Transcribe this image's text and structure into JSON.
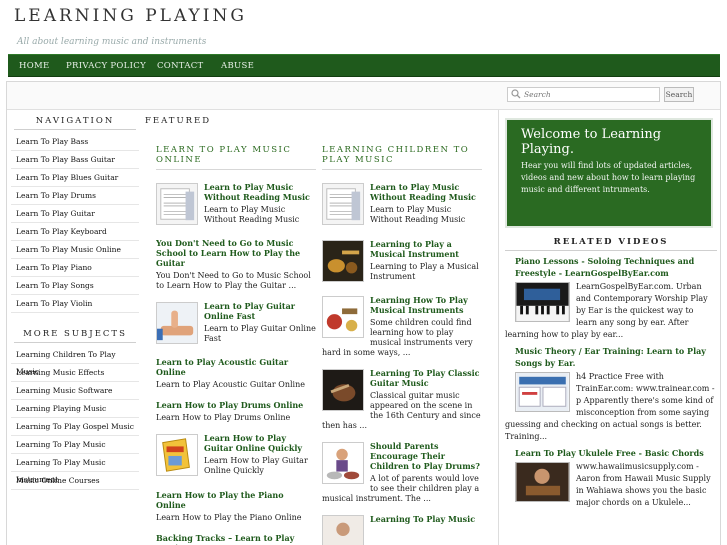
{
  "header": {
    "title": "LEARNING PLAYING",
    "tagline": "All about learning music and instruments"
  },
  "nav": {
    "items": [
      {
        "label": "HOME"
      },
      {
        "label": "PRIVACY POLICY"
      },
      {
        "label": "CONTACT"
      },
      {
        "label": "ABUSE"
      }
    ]
  },
  "search": {
    "placeholder": "Search",
    "button_label": "Search"
  },
  "sidebar": {
    "navigation_title": "NAVIGATION",
    "navigation_items": [
      "Learn To Play Bass",
      "Learn To Play Bass Guitar",
      "Learn To Play Blues Guitar",
      "Learn To Play Drums",
      "Learn To Play Guitar",
      "Learn To Play Keyboard",
      "Learn To Play Music Online",
      "Learn To Play Piano",
      "Learn To Play Songs",
      "Learn To Play Violin"
    ],
    "more_title": "MORE SUBJECTS",
    "more_items": [
      "Learning Children To Play Music",
      "Learning Music Effects",
      "Learning Music Software",
      "Learning Playing Music",
      "Learning To Play Gospel Music",
      "Learning To Play Music",
      "Learning To Play Music Instrument",
      "Music Online Courses"
    ]
  },
  "featured": {
    "title": "FEATURED",
    "col1": {
      "title": "LEARN TO PLAY MUSIC ONLINE",
      "posts": [
        {
          "title": "Learn to Play Music Without Reading Music",
          "desc": "Learn to Play Music Without Reading Music"
        },
        {
          "title": "You Don't Need to Go to Music School to Learn How to Play the Guitar",
          "desc": "You Don't Need to Go to Music School to Learn How to Play the Guitar ..."
        },
        {
          "title": "Learn to Play Guitar Online Fast",
          "desc": "Learn to Play Guitar Online Fast"
        },
        {
          "title": "Learn to Play Acoustic Guitar Online",
          "desc": "Learn to Play Acoustic Guitar Online"
        },
        {
          "title": "Learn How to Play Drums Online",
          "desc": "Learn How to Play Drums Online"
        },
        {
          "title": "Learn How to Play Guitar Online Quickly",
          "desc": "Learn How to Play Guitar Online Quickly"
        },
        {
          "title": "Learn How to Play the Piano Online",
          "desc": "Learn How to Play the Piano Online"
        },
        {
          "title": "Backing Tracks – Learn to Play Music",
          "desc": ""
        }
      ]
    },
    "col2": {
      "title": "LEARNING CHILDREN TO PLAY MUSIC",
      "posts": [
        {
          "title": "Learn to Play Music Without Reading Music",
          "desc": "Learn to Play Music Without Reading Music"
        },
        {
          "title": "Learning to Play a Musical Instrument",
          "desc": "Learning to Play a Musical Instrument"
        },
        {
          "title": "Learning How To Play Musical Instruments",
          "desc": "Some children could find learning how to play musical instruments very hard in some ways, ..."
        },
        {
          "title": "Learning To Play Classic Guitar Music",
          "desc": "Classical guitar music appeared on the scene in the 16th Century and since then has ..."
        },
        {
          "title": "Should Parents Encourage Their Children to Play Drums?",
          "desc": "A lot of parents would love to see their children play a musical instrument. The ..."
        },
        {
          "title": "Learning To Play Music",
          "desc": ""
        }
      ]
    }
  },
  "welcome": {
    "title": "Welcome to Learning Playing.",
    "text": "Hear you will find lots of updated articles, videos and new about how to learn playing music and different intruments."
  },
  "related": {
    "title": "RELATED VIDEOS",
    "videos": [
      {
        "title": "Piano Lessons - Soloing Techniques and Freestyle - LearnGospelByEar.com",
        "desc": "LearnGospelByEar.com. Urban and Contemporary Worship Play by Ear is the quickest way to learn any song by ear. After learning how to play by ear..."
      },
      {
        "title": "Music Theory / Ear Training: Learn to Play Songs by Ear.",
        "desc": "h4 Practice Free with TrainEar.com: www.trainear.com - p Apparently there's some kind of misconception from some saying guessing and checking on actual songs is better. Training..."
      },
      {
        "title": "Learn To Play Ukulele Free - Basic Chords",
        "desc": "www.hawaiimusicsupply.com - Aaron from Hawaii Music Supply in Wahiawa shows you the basic major chords on a Ukulele..."
      }
    ]
  },
  "colors": {
    "nav_bg": "#1f5a1c",
    "link_green": "#1f5a1c",
    "welcome_bg": "#2a6a22"
  }
}
